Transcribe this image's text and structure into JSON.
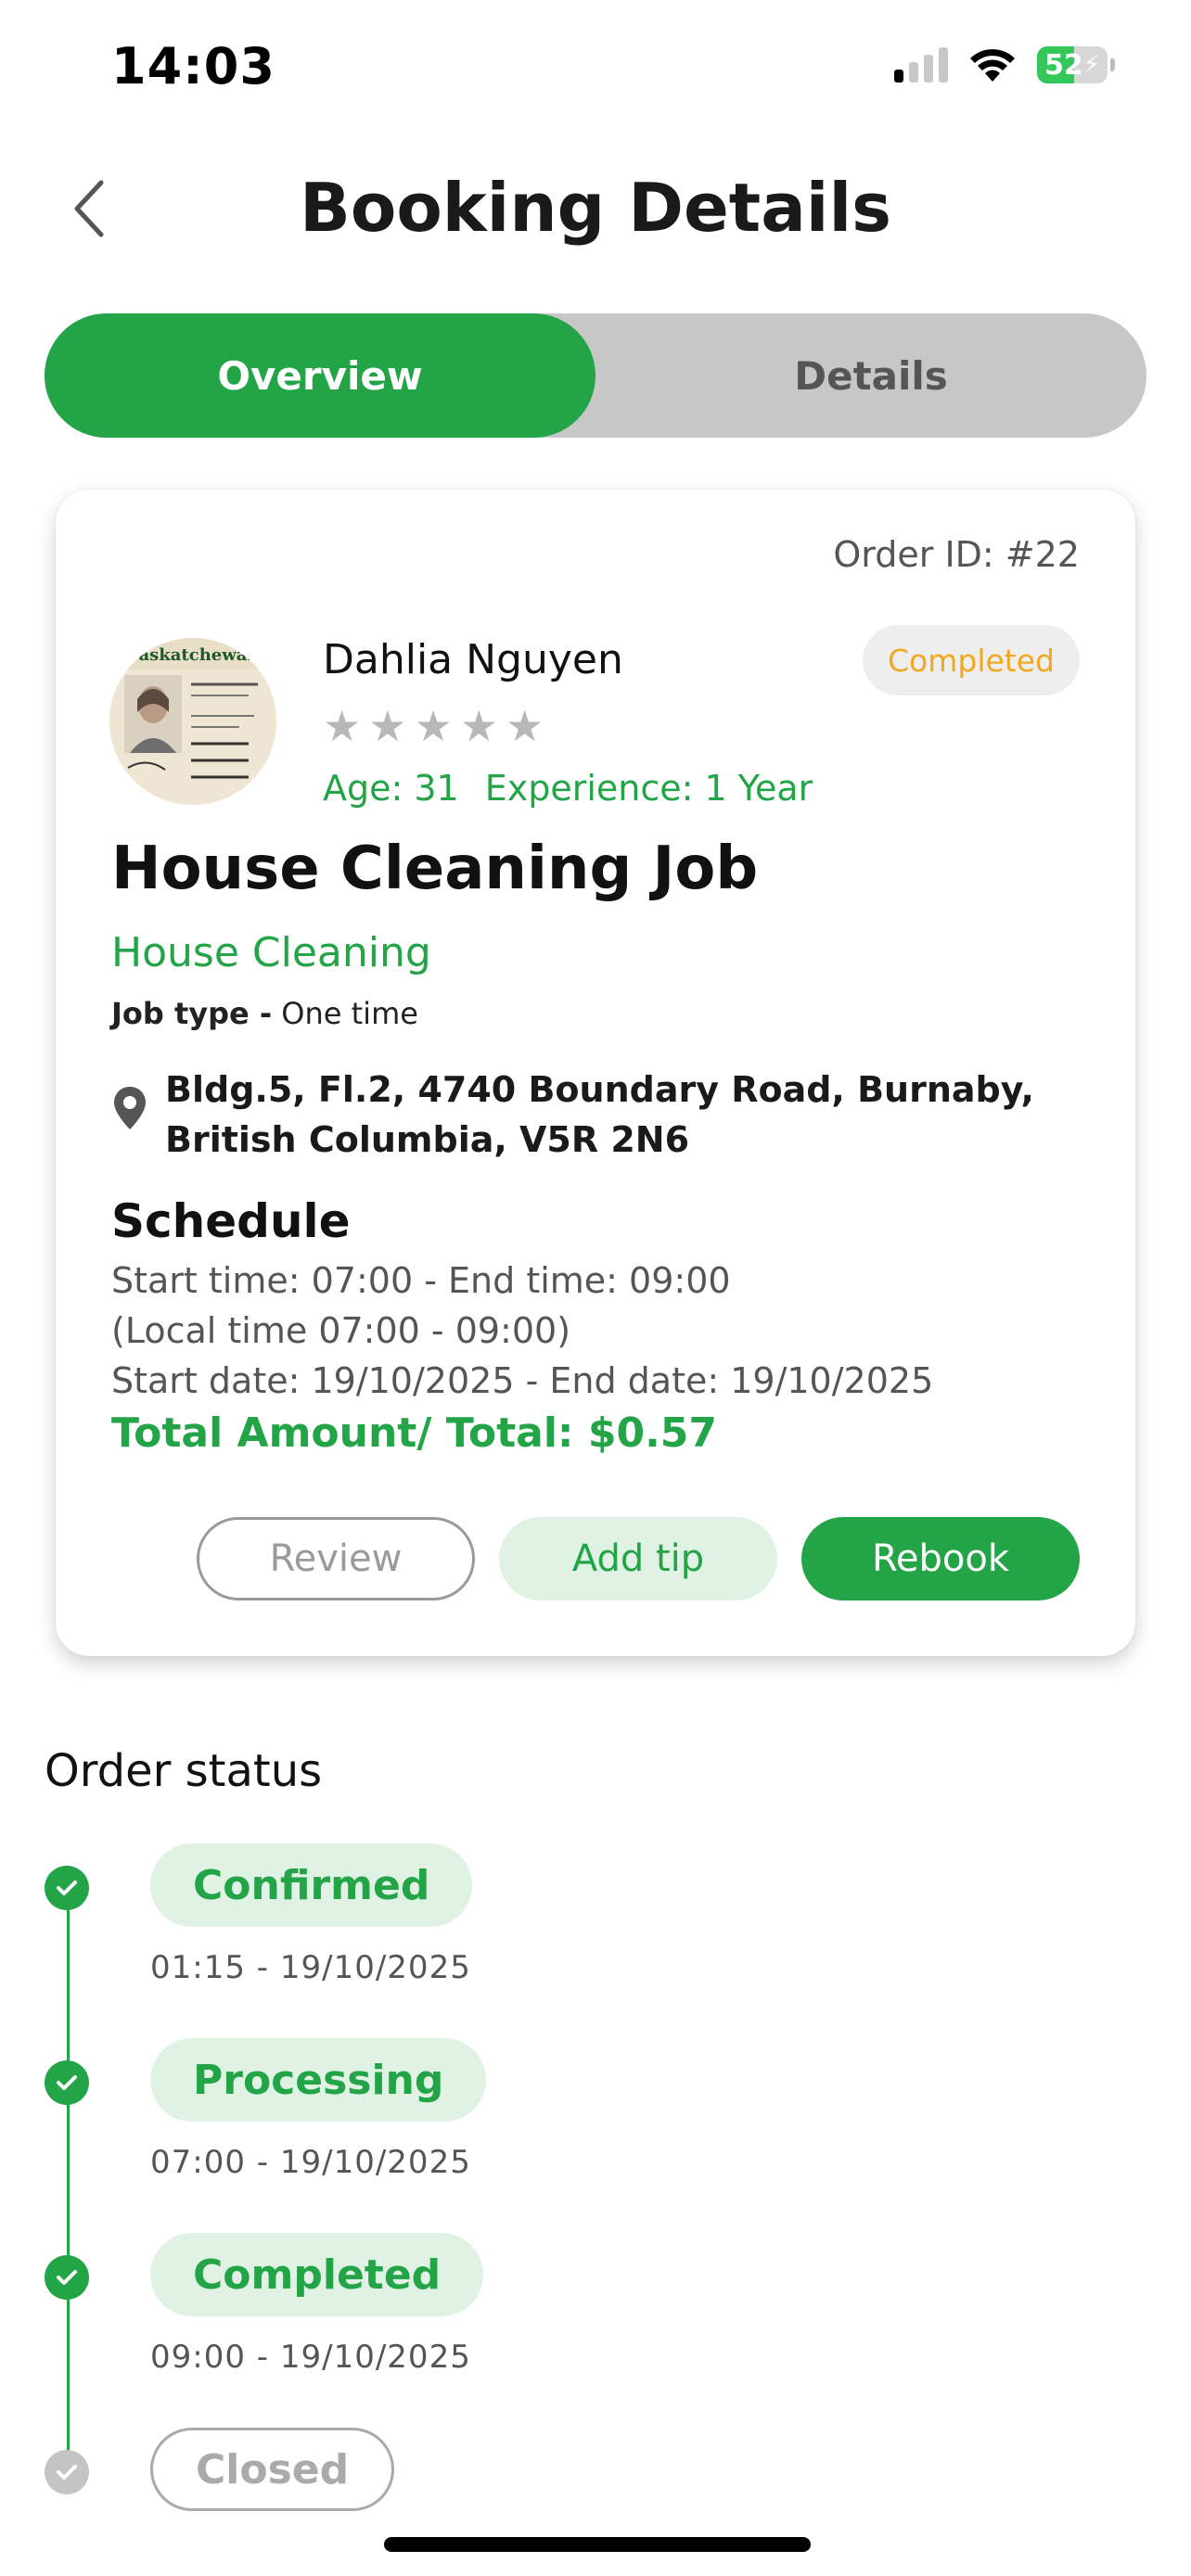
{
  "status_bar": {
    "time": "14:03",
    "battery": "52",
    "battery_level": 0.52
  },
  "header": {
    "title": "Booking Details"
  },
  "tabs": [
    {
      "label": "Overview",
      "active": true
    },
    {
      "label": "Details",
      "active": false
    }
  ],
  "card": {
    "order_id": "Order ID: #22",
    "provider": {
      "name": "Dahlia Nguyen",
      "rating": 0,
      "rating_max": 5,
      "age": "Age: 31",
      "experience": "Experience: 1 Year"
    },
    "status_badge": "Completed",
    "job_title": "House Cleaning Job",
    "job_category": "House Cleaning",
    "job_type_label": "Job type -",
    "job_type_value": "One time",
    "address": "Bldg.5, Fl.2, 4740 Boundary Road, Burnaby, British Columbia, V5R 2N6",
    "schedule": {
      "title": "Schedule",
      "time_line": "Start time: 07:00 - End time: 09:00",
      "local_time_line": "(Local time 07:00 - 09:00)",
      "date_line": "Start date: 19/10/2025 - End date: 19/10/2025"
    },
    "total": "Total Amount/ Total: $0.57",
    "actions": {
      "review": "Review",
      "add_tip": "Add tip",
      "rebook": "Rebook"
    }
  },
  "order_status": {
    "title": "Order status",
    "steps": [
      {
        "label": "Confirmed",
        "time": "01:15 - 19/10/2025",
        "done": true
      },
      {
        "label": "Processing",
        "time": "07:00 - 19/10/2025",
        "done": true
      },
      {
        "label": "Completed",
        "time": "09:00 - 19/10/2025",
        "done": true
      },
      {
        "label": "Closed",
        "time": "",
        "done": false
      }
    ]
  },
  "colors": {
    "brand_green": "#22a447",
    "badge_text": "#f0a820",
    "tab_bg": "#c7c7c7"
  }
}
